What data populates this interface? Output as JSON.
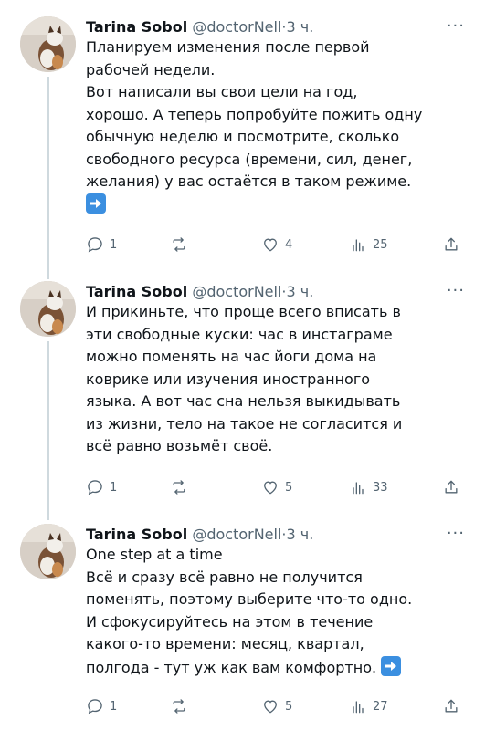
{
  "tweets": [
    {
      "author_name": "Tarina Sobol",
      "handle": "@doctorNell",
      "separator": "·",
      "time": "3 ч.",
      "more_label": "···",
      "lines": [
        "Планируем изменения после первой",
        "рабочей недели.",
        "Вот написали вы свои цели на год,",
        "хорошо. А теперь попробуйте пожить одну",
        "обычную неделю и посмотрите, сколько",
        "свободного ресурса (времени, сил, денег,",
        "желания) у вас остаётся в таком режиме."
      ],
      "trailing_emoji": "➡️",
      "replies": "1",
      "retweets": "",
      "likes": "4",
      "views": "25"
    },
    {
      "author_name": "Tarina Sobol",
      "handle": "@doctorNell",
      "separator": "·",
      "time": "3 ч.",
      "more_label": "···",
      "lines": [
        "И прикиньте, что проще всего вписать в",
        "эти свободные куски: час в инстаграме",
        "можно поменять на час йоги дома на",
        "коврике или изучения иностранного",
        "языка. А вот час сна нельзя выкидывать",
        "из жизни, тело на такое не согласится и",
        "всё равно возьмёт своё."
      ],
      "replies": "1",
      "retweets": "",
      "likes": "5",
      "views": "33"
    },
    {
      "author_name": "Tarina Sobol",
      "handle": "@doctorNell",
      "separator": "·",
      "time": "3 ч.",
      "more_label": "···",
      "lines": [
        "One step at a time",
        "Всё и сразу всё равно не получится",
        "поменять,  поэтому выберите что-то одно.",
        "И сфокусируйтесь на этом в течение",
        "какого-то времени: месяц, квартал,",
        "полгода - тут уж как вам комфортно."
      ],
      "inline_emoji": "➡️",
      "replies": "1",
      "retweets": "",
      "likes": "5",
      "views": "27"
    }
  ],
  "icons": {
    "reply": "reply-icon",
    "retweet": "retweet-icon",
    "like": "heart-icon",
    "views": "views-chart-icon",
    "share": "share-icon",
    "emoji": "right-arrow-emoji"
  },
  "colors": {
    "text": "#0f1419",
    "muted": "#536471",
    "thread_line": "#cfd9de",
    "emoji_bg": "#3b8fe0"
  }
}
